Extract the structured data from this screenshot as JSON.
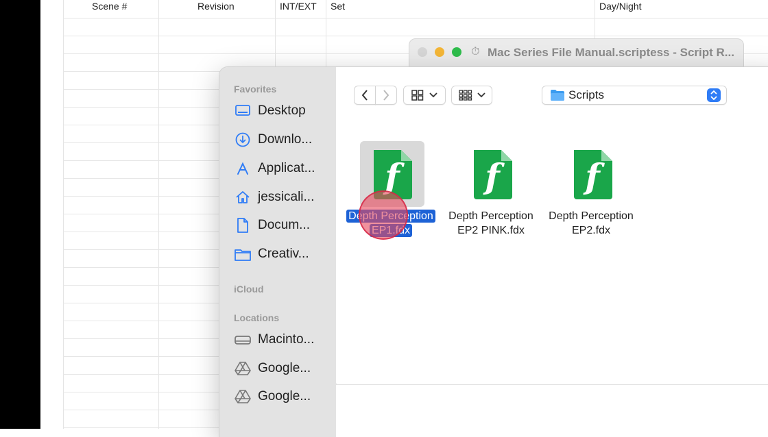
{
  "spreadsheet": {
    "columns": [
      "Scene #",
      "Revision",
      "INT/EXT",
      "Set",
      "Day/Night"
    ]
  },
  "back_window": {
    "title": "Mac Series File Manual.scriptess - Script R..."
  },
  "sidebar": {
    "sections": [
      {
        "label": "Favorites",
        "items": [
          {
            "label": "Desktop",
            "icon": "desktop-icon"
          },
          {
            "label": "Downlo...",
            "icon": "download-icon"
          },
          {
            "label": "Applicat...",
            "icon": "applications-icon"
          },
          {
            "label": "jessicali...",
            "icon": "home-icon"
          },
          {
            "label": "Docum...",
            "icon": "document-icon"
          },
          {
            "label": "Creativ...",
            "icon": "folder-icon"
          }
        ]
      },
      {
        "label": "iCloud",
        "items": []
      },
      {
        "label": "Locations",
        "items": [
          {
            "label": "Macinto...",
            "icon": "disk-icon"
          },
          {
            "label": "Google...",
            "icon": "google-drive-icon"
          },
          {
            "label": "Google...",
            "icon": "google-drive-icon"
          }
        ]
      }
    ]
  },
  "toolbar": {
    "location": "Scripts"
  },
  "files": [
    {
      "name": "Depth Perception EP1.fdx",
      "line1": "Depth Perception",
      "line2": "EP1.fdx",
      "selected": true
    },
    {
      "name": "Depth Perception EP2 PINK.fdx",
      "line1": "Depth Perception",
      "line2": "EP2 PINK.fdx",
      "selected": false
    },
    {
      "name": "Depth Perception EP2.fdx",
      "line1": "Depth Perception",
      "line2": "EP2.fdx",
      "selected": false
    }
  ],
  "colors": {
    "accent": "#1d62d6",
    "folder": "#3b9cf0",
    "fdx_green": "#1aa64a",
    "close": "#d6d6d6",
    "minimize": "#f4b637",
    "zoom": "#2fbd4c"
  }
}
